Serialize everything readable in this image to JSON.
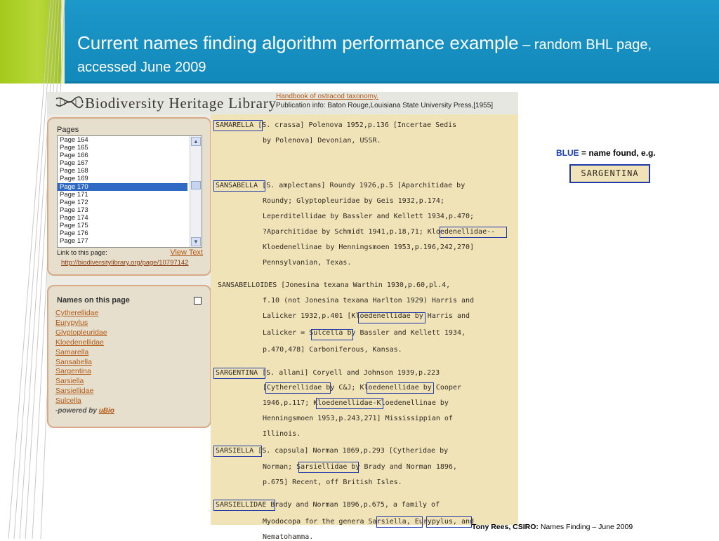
{
  "slide": {
    "title_main": "Current names finding algorithm performance example",
    "title_rest": " – random BHL page, accessed June 2009",
    "footer_author": "Tony Rees, CSIRO:",
    "footer_rest": " Names Finding – June 2009",
    "accent_color": "#1a98c8",
    "lime_color": "#a8cc20"
  },
  "bhl": {
    "logo_text": "Biodiversity Heritage Library",
    "book_title": "Handbook of ostracod taxonomy.",
    "pub_info": "Publication info: Baton Rouge,Louisiana State University Press,[1955]",
    "pages_title": "Pages",
    "pages": [
      "Page 164",
      "Page 165",
      "Page 166",
      "Page 167",
      "Page 168",
      "Page 169",
      "Page 170",
      "Page 171",
      "Page 172",
      "Page 173",
      "Page 174",
      "Page 175",
      "Page 176",
      "Page 177"
    ],
    "selected_page": "Page 170",
    "link_label": "Link to this page:",
    "view_text": "View Text",
    "page_url": "http://biodiversitylibrary.org/page/10797142",
    "names_title": "Names on this page",
    "names": [
      "Cytherellidae",
      "Eurypylus",
      "Glyptopleuridae",
      "Kloedenellidae",
      "Samarella",
      "Sansabella",
      "Sargentina",
      "Sarsiella",
      "Sarsiellidae",
      "Sulcella"
    ],
    "powered_by": "-powered by",
    "powered_by_link": "uBio"
  },
  "scan_lines": [
    "SAMARELLA [S. crassa] Polenova 1952,p.136 [Incertae Sedis",
    "by Polenova] Devonian, USSR.",
    "SANSABELLA [S. amplectans] Roundy 1926,p.5 [Aparchitidae by",
    "Roundy; Glyptopleuridae by Geis 1932,p.174;",
    "Leperditellidae by Bassler and Kellett 1934,p.470;",
    "?Aparchitidae by Schmidt 1941,p.18,71; Kloedenellidae--",
    "Kloedenellinae by Henningsmoen 1953,p.196,242,270]",
    "Pennsylvanian, Texas.",
    "SANSABELLOIDES [Jonesina texana Warthin 1930,p.60,pl.4,",
    "f.10 (not Jonesina texana Harlton 1929) Harris and",
    "Lalicker 1932,p.401 [Kloedenellidae by Harris and",
    "Lalicker = Sulcella by Bassler and Kellett 1934,",
    "p.470,478] Carboniferous, Kansas.",
    "SARGENTINA [S. allani] Coryell and Johnson 1939,p.223",
    "[Cytherellidae by C&J; Kloedenellidae by Cooper",
    "1946,p.117; Kloedenellidae-Kloedenellinae by",
    "Henningsmoen 1953,p.243,271] Mississippian of",
    "Illinois.",
    "SARSIELLA [S. capsula] Norman 1869,p.293 [Cytheridae by",
    "Norman; Sarsiellidae by Brady and Norman 1896,",
    "p.675] Recent, off British Isles.",
    "SARSIELLIDAE Brady and Norman 1896,p.675, a family of",
    "Myodocopa for the genera Sarsiella, Eurypylus, and",
    "Nematohamma."
  ],
  "legend": {
    "blue_word": "BLUE",
    "rest": " = name found, e.g.",
    "example": "SARGENTINA"
  }
}
